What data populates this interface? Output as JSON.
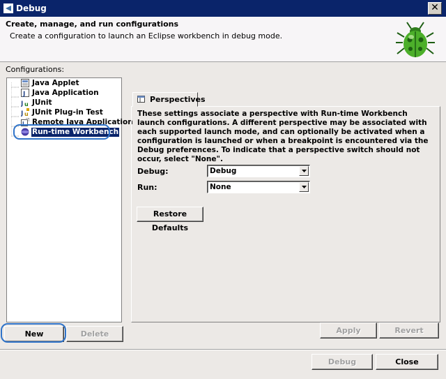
{
  "window": {
    "title": "Debug",
    "close_glyph": "✕"
  },
  "banner": {
    "heading": "Create, manage, and run configurations",
    "message": "Create a configuration to launch an Eclipse workbench in debug mode.",
    "image": "bug-icon"
  },
  "configurations": {
    "label": "Configurations:",
    "items": [
      {
        "label": "Java Applet",
        "icon": "applet-icon"
      },
      {
        "label": "Java Application",
        "icon": "java-app-icon"
      },
      {
        "label": "JUnit",
        "icon": "junit-icon"
      },
      {
        "label": "JUnit Plug-in Test",
        "icon": "junit-plugin-icon"
      },
      {
        "label": "Remote Java Application",
        "icon": "remote-app-icon"
      },
      {
        "label": "Run-time Workbench",
        "icon": "workbench-icon",
        "selected": true
      }
    ],
    "new_label": "New",
    "delete_label": "Delete"
  },
  "tab": {
    "label": "Perspectives",
    "icon": "perspective-icon"
  },
  "perspectives": {
    "description": "These settings associate a perspective with Run-time Workbench launch configurations. A different perspective may be associated with each supported launch mode, and can optionally be activated when a configuration is launched or when a breakpoint is encountered via the Debug preferences. To indicate that a perspective switch should not occur, select \"None\".",
    "debug_label": "Debug:",
    "debug_value": "Debug",
    "run_label": "Run:",
    "run_value": "None",
    "restore_label": "Restore Defaults"
  },
  "actions": {
    "apply_label": "Apply",
    "revert_label": "Revert",
    "debug_label": "Debug",
    "close_label": "Close"
  },
  "colors": {
    "titlebar": "#0a246a",
    "selection": "#0a246a",
    "highlight_ring": "#2f73c9",
    "dialog_bg": "#ece9e6"
  }
}
